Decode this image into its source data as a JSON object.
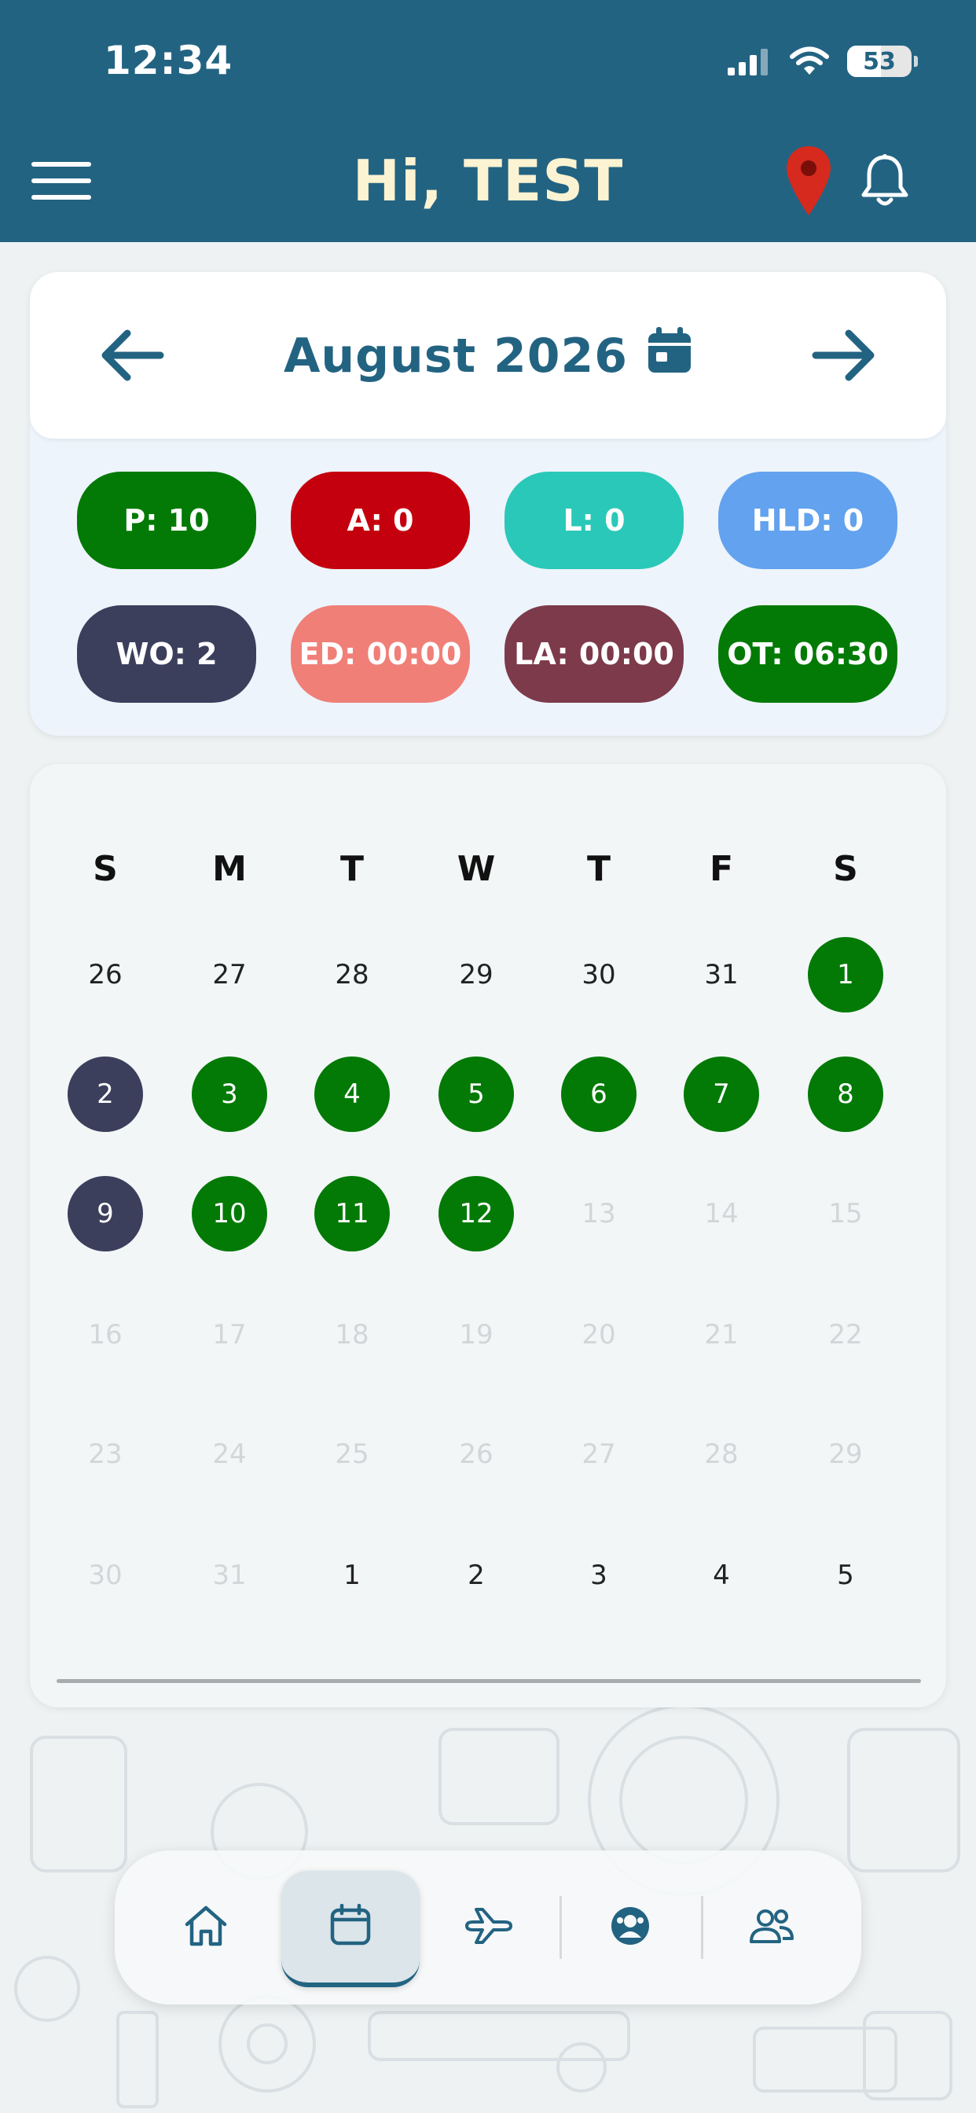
{
  "status_bar": {
    "time": "12:34",
    "battery": "53",
    "battery_level": 0.53
  },
  "header": {
    "title": "Hi, TEST",
    "menu_icon": "hamburger-menu-icon",
    "location_icon": "map-pin-icon",
    "notification_icon": "bell-icon"
  },
  "month": {
    "title": "August 2026",
    "prev_icon": "arrow-left-icon",
    "next_icon": "arrow-right-icon",
    "picker_icon": "calendar-icon"
  },
  "summary": [
    {
      "label": "P: 10",
      "color": "#027a05"
    },
    {
      "label": "A: 0",
      "color": "#c5000e"
    },
    {
      "label": "L: 0",
      "color": "#2ac8b8"
    },
    {
      "label": "HLD: 0",
      "color": "#62a2ee"
    },
    {
      "label": "WO: 2",
      "color": "#3b3f5c"
    },
    {
      "label": "ED: 00:00",
      "color": "#f07f78"
    },
    {
      "label": "LA: 00:00",
      "color": "#7c3a4a"
    },
    {
      "label": "OT: 06:30",
      "color": "#027a05"
    }
  ],
  "calendar": {
    "weekdays": [
      "S",
      "M",
      "T",
      "W",
      "T",
      "F",
      "S"
    ],
    "weeks": [
      [
        {
          "d": "26",
          "s": "outside"
        },
        {
          "d": "27",
          "s": "outside"
        },
        {
          "d": "28",
          "s": "outside"
        },
        {
          "d": "29",
          "s": "outside"
        },
        {
          "d": "30",
          "s": "outside"
        },
        {
          "d": "31",
          "s": "outside"
        },
        {
          "d": "1",
          "s": "present"
        }
      ],
      [
        {
          "d": "2",
          "s": "weekoff"
        },
        {
          "d": "3",
          "s": "present"
        },
        {
          "d": "4",
          "s": "present"
        },
        {
          "d": "5",
          "s": "present"
        },
        {
          "d": "6",
          "s": "present"
        },
        {
          "d": "7",
          "s": "present"
        },
        {
          "d": "8",
          "s": "present"
        }
      ],
      [
        {
          "d": "9",
          "s": "weekoff"
        },
        {
          "d": "10",
          "s": "present"
        },
        {
          "d": "11",
          "s": "present"
        },
        {
          "d": "12",
          "s": "present"
        },
        {
          "d": "13",
          "s": "future"
        },
        {
          "d": "14",
          "s": "future"
        },
        {
          "d": "15",
          "s": "future"
        }
      ],
      [
        {
          "d": "16",
          "s": "future"
        },
        {
          "d": "17",
          "s": "future"
        },
        {
          "d": "18",
          "s": "future"
        },
        {
          "d": "19",
          "s": "future"
        },
        {
          "d": "20",
          "s": "future"
        },
        {
          "d": "21",
          "s": "future"
        },
        {
          "d": "22",
          "s": "future"
        }
      ],
      [
        {
          "d": "23",
          "s": "future"
        },
        {
          "d": "24",
          "s": "future"
        },
        {
          "d": "25",
          "s": "future"
        },
        {
          "d": "26",
          "s": "future"
        },
        {
          "d": "27",
          "s": "future"
        },
        {
          "d": "28",
          "s": "future"
        },
        {
          "d": "29",
          "s": "future"
        }
      ],
      [
        {
          "d": "30",
          "s": "future"
        },
        {
          "d": "31",
          "s": "future"
        },
        {
          "d": "1",
          "s": "outside"
        },
        {
          "d": "2",
          "s": "outside"
        },
        {
          "d": "3",
          "s": "outside"
        },
        {
          "d": "4",
          "s": "outside"
        },
        {
          "d": "5",
          "s": "outside"
        }
      ]
    ]
  },
  "bottom_nav": {
    "items": [
      {
        "icon": "home-icon",
        "active": false
      },
      {
        "icon": "calendar-icon",
        "active": true
      },
      {
        "icon": "airplane-icon",
        "active": false
      },
      {
        "icon": "user-face-icon",
        "active": false
      },
      {
        "icon": "team-icon",
        "active": false
      }
    ]
  }
}
